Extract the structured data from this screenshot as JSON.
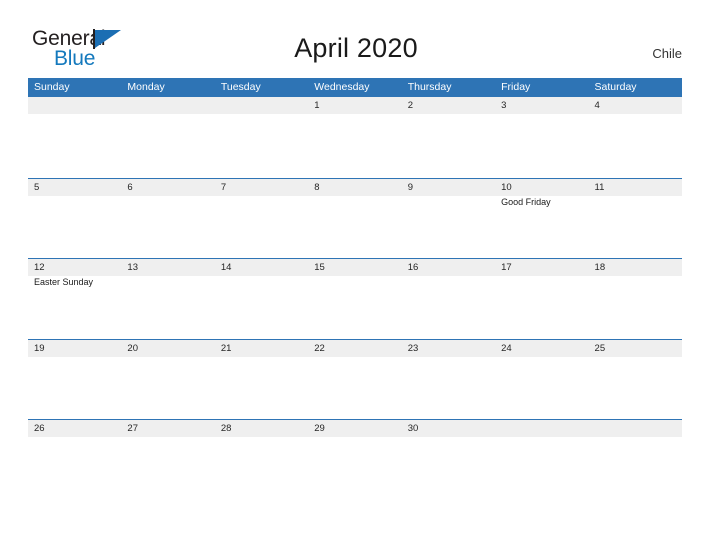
{
  "brand": {
    "name_part1": "General",
    "name_part2": "Blue",
    "color_dark": "#231f20",
    "color_blue": "#1479bd"
  },
  "header": {
    "title": "April 2020",
    "country": "Chile"
  },
  "theme": {
    "header_blue": "#2e74b5",
    "band_gray": "#efefef",
    "text": "#262626"
  },
  "calendar": {
    "day_names": [
      "Sunday",
      "Monday",
      "Tuesday",
      "Wednesday",
      "Thursday",
      "Friday",
      "Saturday"
    ],
    "weeks": [
      [
        {
          "day": "",
          "events": []
        },
        {
          "day": "",
          "events": []
        },
        {
          "day": "",
          "events": []
        },
        {
          "day": "1",
          "events": []
        },
        {
          "day": "2",
          "events": []
        },
        {
          "day": "3",
          "events": []
        },
        {
          "day": "4",
          "events": []
        }
      ],
      [
        {
          "day": "5",
          "events": []
        },
        {
          "day": "6",
          "events": []
        },
        {
          "day": "7",
          "events": []
        },
        {
          "day": "8",
          "events": []
        },
        {
          "day": "9",
          "events": []
        },
        {
          "day": "10",
          "events": [
            "Good Friday"
          ]
        },
        {
          "day": "11",
          "events": []
        }
      ],
      [
        {
          "day": "12",
          "events": [
            "Easter Sunday"
          ]
        },
        {
          "day": "13",
          "events": []
        },
        {
          "day": "14",
          "events": []
        },
        {
          "day": "15",
          "events": []
        },
        {
          "day": "16",
          "events": []
        },
        {
          "day": "17",
          "events": []
        },
        {
          "day": "18",
          "events": []
        }
      ],
      [
        {
          "day": "19",
          "events": []
        },
        {
          "day": "20",
          "events": []
        },
        {
          "day": "21",
          "events": []
        },
        {
          "day": "22",
          "events": []
        },
        {
          "day": "23",
          "events": []
        },
        {
          "day": "24",
          "events": []
        },
        {
          "day": "25",
          "events": []
        }
      ],
      [
        {
          "day": "26",
          "events": []
        },
        {
          "day": "27",
          "events": []
        },
        {
          "day": "28",
          "events": []
        },
        {
          "day": "29",
          "events": []
        },
        {
          "day": "30",
          "events": []
        },
        {
          "day": "",
          "events": []
        },
        {
          "day": "",
          "events": []
        }
      ]
    ]
  }
}
